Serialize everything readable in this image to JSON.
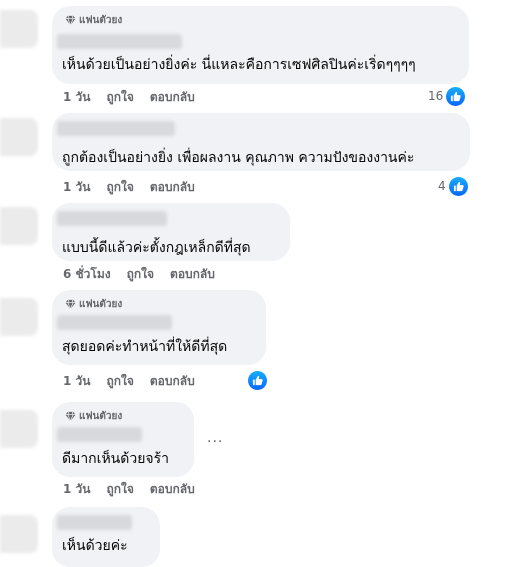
{
  "comments": [
    {
      "badge": "แฟนตัวยง",
      "text": "เห็นด้วยเป็นอย่างยิ่งค่ะ นี่แหละคือการเซฟศิลปินค่ะเริ่ดๆๆๆๆ",
      "time": "1 วัน",
      "like": "ถูกใจ",
      "reply": "ตอบกลับ",
      "reactions": "16"
    },
    {
      "badge": "",
      "text": "ถูกต้องเป็นอย่างยิ่ง เพื่อผลงาน คุณภาพ ความปังของงานค่ะ",
      "time": "1 วัน",
      "like": "ถูกใจ",
      "reply": "ตอบกลับ",
      "reactions": "4"
    },
    {
      "badge": "",
      "text": "แบบนี้ดีแล้วค่ะตั้งกฎเหล็กดีที่สุด",
      "time": "6 ชั่วโมง",
      "like": "ถูกใจ",
      "reply": "ตอบกลับ",
      "reactions": ""
    },
    {
      "badge": "แฟนตัวยง",
      "text": "สุดยอดค่ะทำหน้าที่ให้ดีที่สุด",
      "time": "1 วัน",
      "like": "ถูกใจ",
      "reply": "ตอบกลับ",
      "reactions": ""
    },
    {
      "badge": "แฟนตัวยง",
      "text": "ดีมากเห็นด้วยจร้า",
      "time": "1 วัน",
      "like": "ถูกใจ",
      "reply": "ตอบกลับ",
      "reactions": ""
    },
    {
      "badge": "",
      "text": "เห็นด้วยค่ะ",
      "time": "",
      "like": "",
      "reply": "",
      "reactions": ""
    }
  ],
  "more_label": "...",
  "colors": {
    "bubble": "#f0f2f5",
    "like_blue": "#0866ff",
    "meta_gray": "#65676b"
  },
  "icons": {
    "badge": "diamond-icon",
    "reaction": "thumbs-up-icon"
  }
}
